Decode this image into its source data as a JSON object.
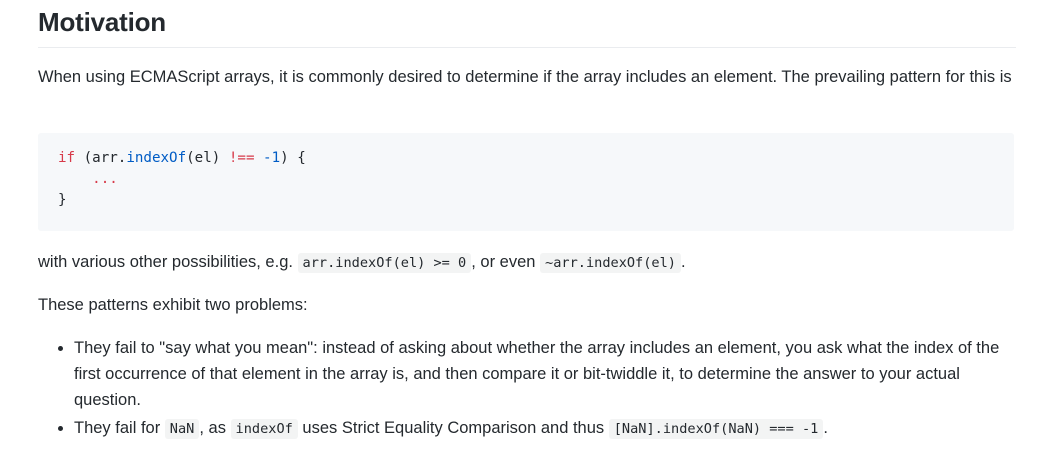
{
  "heading": "Motivation",
  "intro": "When using ECMAScript arrays, it is commonly desired to determine if the array includes an element. The prevailing pattern for this is",
  "code_block": {
    "line1": {
      "kw": "if",
      "open": " (arr.",
      "fn": "indexOf",
      "arg": "(el) ",
      "op": "!==",
      "sp": " ",
      "num": "-1",
      "close": ") {"
    },
    "line2": "...",
    "line3": "}"
  },
  "para2": {
    "prefix": "with various other possibilities, e.g. ",
    "code1": "arr.indexOf(el) >= 0",
    "middle": ", or even ",
    "code2": "~arr.indexOf(el)",
    "suffix": "."
  },
  "para3": "These patterns exhibit two problems:",
  "bullets": {
    "b1": "They fail to \"say what you mean\": instead of asking about whether the array includes an element, you ask what the index of the first occurrence of that element in the array is, and then compare it or bit-twiddle it, to determine the answer to your actual question.",
    "b2": {
      "prefix": "They fail for ",
      "code1": "NaN",
      "mid1": ", as ",
      "code2": "indexOf",
      "mid2": " uses Strict Equality Comparison and thus ",
      "code3": "[NaN].indexOf(NaN) === -1",
      "suffix": "."
    }
  }
}
